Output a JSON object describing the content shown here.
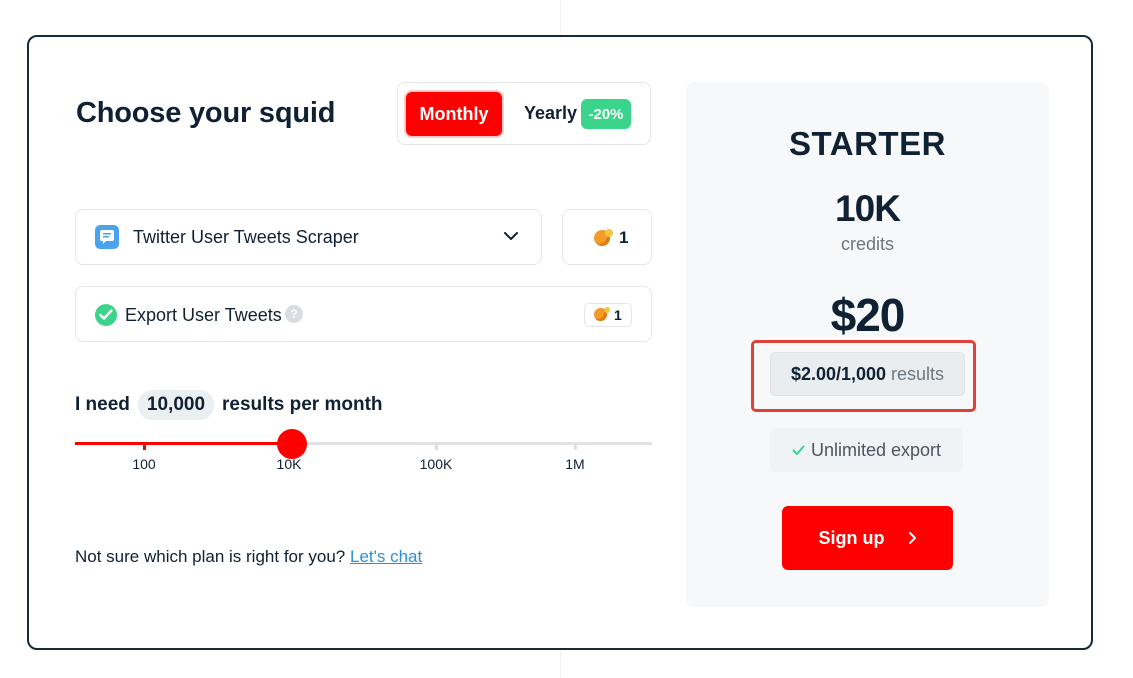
{
  "heading": "Choose your squid",
  "billing_toggle": {
    "monthly_label": "Monthly",
    "yearly_label": "Yearly",
    "yearly_discount": "-20%",
    "selected": "Monthly"
  },
  "scraper": {
    "selected_label": "Twitter User Tweets Scraper",
    "icon": "chat-bubble-icon",
    "credit_cost": "1"
  },
  "export_option": {
    "label": "Export User Tweets",
    "help": "?",
    "checked": true,
    "credit_cost": "1"
  },
  "results_needed": {
    "prefix": "I need",
    "value": "10,000",
    "suffix": "results per month"
  },
  "slider": {
    "ticks": [
      "100",
      "10K",
      "100K",
      "1M"
    ],
    "selected_index": 1
  },
  "help_text": {
    "prompt": "Not sure which plan is right for you?",
    "link_label": "Let's chat"
  },
  "plan": {
    "name": "STARTER",
    "credits_amount": "10K",
    "credits_label": "credits",
    "price": "$20",
    "per_result_amount": "$2.00/1,000",
    "per_result_unit": "results",
    "feature": "Unlimited export",
    "cta_label": "Sign up"
  },
  "colors": {
    "accent": "#ff0000",
    "success": "#3ad48a",
    "text": "#0f2133",
    "highlight_border": "#e0403a"
  }
}
